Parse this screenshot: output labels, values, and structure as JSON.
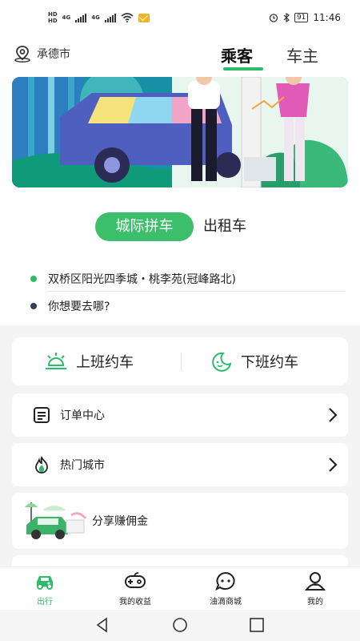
{
  "status_bar": {
    "hd_labels": [
      "HD",
      "HD"
    ],
    "network_labels": [
      "4G",
      "4G"
    ],
    "battery": "91",
    "time": "11:46",
    "icons": [
      "signal-icon",
      "wifi-icon",
      "mail-notification-icon",
      "alarm-icon",
      "bluetooth-icon",
      "battery-icon"
    ]
  },
  "header": {
    "location_icon": "location-pin-icon",
    "city": "承德市",
    "tabs": [
      {
        "label": "乘客",
        "active": true
      },
      {
        "label": "车主",
        "active": false
      }
    ],
    "accent_color": "#2dbd6a"
  },
  "banner": {
    "description_icon": "car-banner-illustration"
  },
  "ride_modes": {
    "active": "城际拼车",
    "inactive": "出租车"
  },
  "route": {
    "from": "双桥区阳光四季城・桃李苑(冠峰路北)",
    "to_placeholder": "你想要去哪?"
  },
  "commute": {
    "up_label": "上班约车",
    "up_icon": "sunrise-icon",
    "down_label": "下班约车",
    "down_icon": "moon-icon"
  },
  "menu": {
    "orders": {
      "label": "订单中心",
      "icon": "document-icon"
    },
    "hot_cities": {
      "label": "热门城市",
      "icon": "fire-icon"
    },
    "share": {
      "label": "分享赚佣金",
      "icon": "car-illustration"
    }
  },
  "bottom_nav": [
    {
      "label": "出行",
      "icon": "car-icon",
      "active": true
    },
    {
      "label": "我的收益",
      "icon": "gamepad-icon",
      "active": false
    },
    {
      "label": "油滴商城",
      "icon": "chat-bubble-icon",
      "active": false
    },
    {
      "label": "我的",
      "icon": "user-icon",
      "active": false
    }
  ],
  "system_nav": [
    "back-icon",
    "home-icon",
    "recents-icon"
  ]
}
